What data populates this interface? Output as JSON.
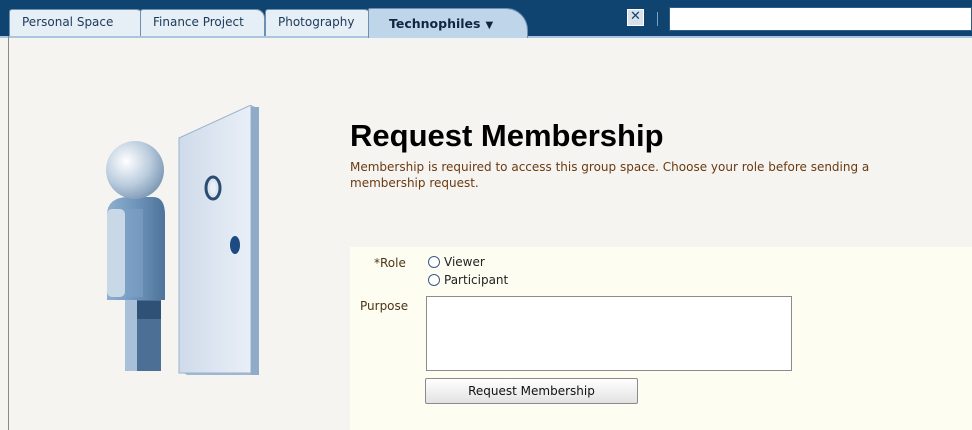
{
  "tabs": [
    {
      "label": "Personal Space",
      "active": false
    },
    {
      "label": "Finance Project",
      "active": false
    },
    {
      "label": "Photography",
      "active": false
    },
    {
      "label": "Technophiles",
      "active": true
    }
  ],
  "tab_close_icon": "close-icon",
  "tab_menu_icon": "dropdown-arrow-icon",
  "page": {
    "title": "Request Membership",
    "description": "Membership is required to access this group space. Choose your role before sending a membership request."
  },
  "form": {
    "role_required_marker": "*",
    "role_label": "Role",
    "role_options": [
      "Viewer",
      "Participant"
    ],
    "purpose_label": "Purpose",
    "purpose_value": "",
    "submit_label": "Request Membership"
  },
  "colors": {
    "tab_bar": "#0f4471",
    "active_tab": "#bfd6ea",
    "form_background": "#fdfdf1",
    "description_text": "#6a3a10"
  },
  "illustration_icon": "person-at-door-icon"
}
